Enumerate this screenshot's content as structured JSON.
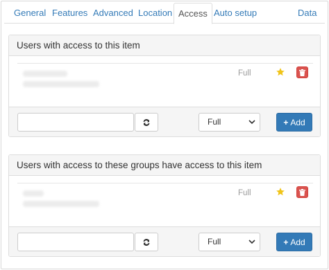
{
  "tabs": [
    {
      "label": "General",
      "active": false
    },
    {
      "label": "Features",
      "active": false
    },
    {
      "label": "Advanced",
      "active": false
    },
    {
      "label": "Location",
      "active": false
    },
    {
      "label": "Access",
      "active": true
    },
    {
      "label": "Auto setup",
      "active": false
    },
    {
      "label": "Data",
      "active": false
    }
  ],
  "user_access": {
    "heading": "Users with access to this item",
    "entry": {
      "access_level": "Full",
      "star_icon": "star-icon",
      "delete_icon": "trash-icon"
    },
    "footer": {
      "input_value": "",
      "refresh_icon": "refresh-icon",
      "select_value": "Full",
      "add_label": "Add"
    }
  },
  "group_access": {
    "heading": "Users with access to these groups have access to this item",
    "entry": {
      "access_level": "Full",
      "star_icon": "star-icon",
      "delete_icon": "trash-icon"
    },
    "footer": {
      "input_value": "",
      "refresh_icon": "refresh-icon",
      "select_value": "Full",
      "add_label": "Add"
    }
  },
  "colors": {
    "link": "#337ab7",
    "danger": "#d9534f",
    "star": "#f0c419",
    "primary": "#337ab7"
  }
}
